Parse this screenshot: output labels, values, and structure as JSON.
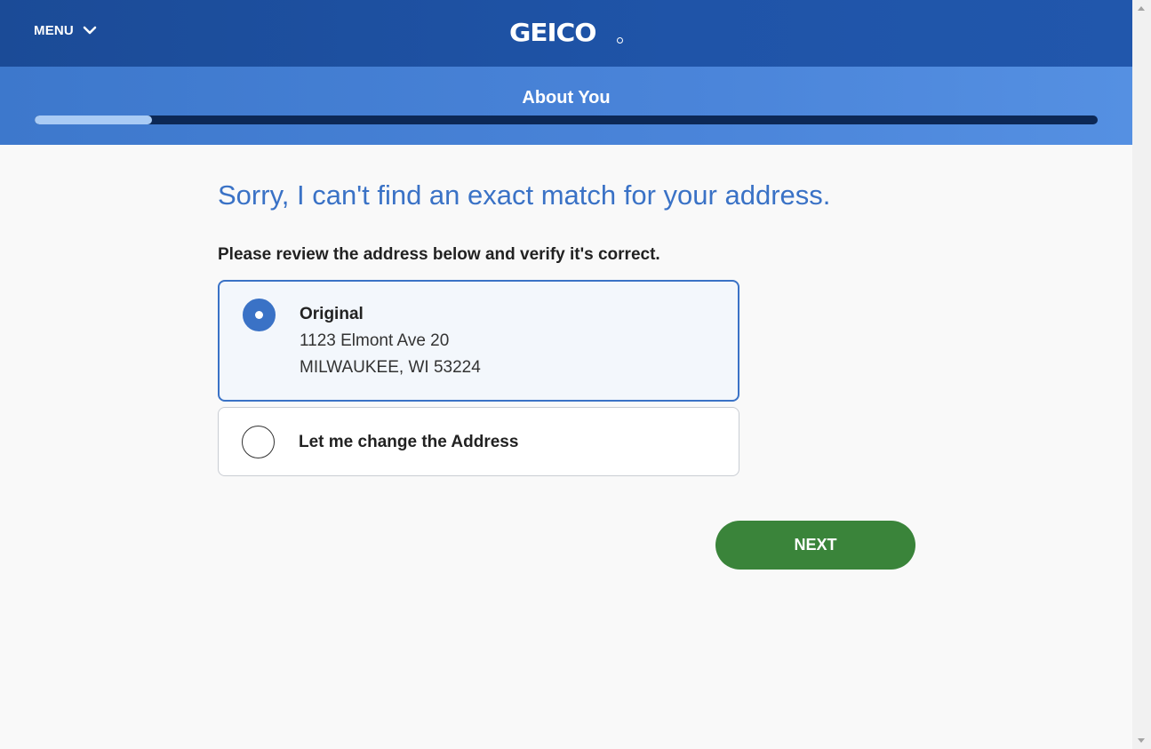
{
  "header": {
    "menu_label": "MENU",
    "logo_text": "GEICO"
  },
  "subheader": {
    "section_title": "About You",
    "progress_fraction": 0.11
  },
  "main": {
    "heading": "Sorry, I can't find an exact match for your address.",
    "instruction": "Please review the address below and verify it's correct.",
    "options": [
      {
        "title": "Original",
        "address_line_1": "1123 Elmont Ave 20",
        "address_line_2": "MILWAUKEE, WI 53224",
        "selected": true
      },
      {
        "title": "Let me change the Address",
        "selected": false
      }
    ],
    "next_label": "NEXT"
  },
  "colors": {
    "topbar": "#1f54a8",
    "subheader": "#4a84d9",
    "progress_track": "#0c2856",
    "progress_fill": "#a9cbf5",
    "heading": "#3a72c6",
    "next_button": "#3a843a"
  }
}
